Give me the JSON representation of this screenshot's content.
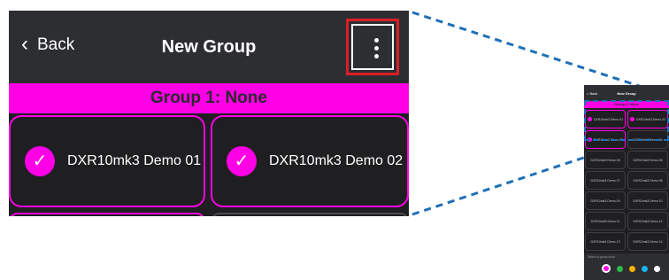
{
  "header": {
    "back_label": "Back",
    "title": "New Group",
    "more_icon": "more-vertical-icon"
  },
  "group_bar": {
    "text": "Group 1: None",
    "color": "#ff00e6"
  },
  "cards": [
    {
      "label": "DXR10mk3 Demo 01",
      "selected": true
    },
    {
      "label": "DXR10mk3 Demo 02",
      "selected": true
    }
  ],
  "thumbnail": {
    "back_label": "< Back",
    "title": "New Group",
    "group_text": "Group 1: None",
    "items": [
      "DXR10mk3 Demo 01",
      "DXR10mk3 Demo 02",
      "DXR10mk3 Demo 03",
      "DXR10mk3 Demo 04",
      "DXR10mk3 Demo 05",
      "DXR10mk3 Demo 06",
      "DXR10mk3 Demo 07",
      "DXR10mk3 Demo 08",
      "DXR10mk3 Demo 09",
      "DXR10mk3 Demo 10",
      "DXR10mk3 Demo 11",
      "DXR10mk3 Demo 12",
      "DXR10mk3 Demo 13",
      "DXR10mk3 Demo 14"
    ],
    "footer_hint": "Select a group color",
    "swatch_colors": [
      "#ff00e6",
      "#2dbb4e",
      "#f5b400",
      "#18b4f0",
      "#ffffff"
    ]
  },
  "colors": {
    "accent": "#ff00e6",
    "highlight_frame": "#d91f26",
    "connector": "#1e6fb8"
  }
}
